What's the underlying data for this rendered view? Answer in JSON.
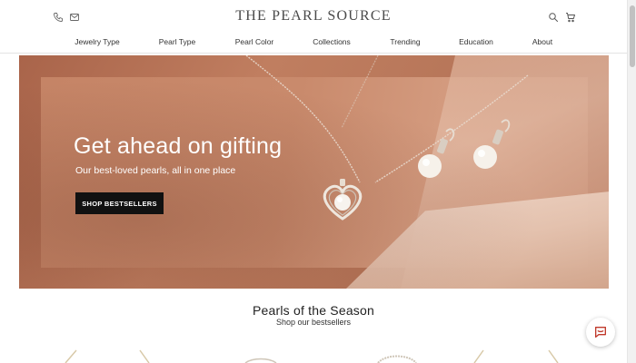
{
  "header": {
    "logo": "THE PEARL SOURCE",
    "icons": [
      "phone-icon",
      "mail-icon",
      "search-icon",
      "cart-icon"
    ]
  },
  "nav": {
    "items": [
      {
        "label": "Jewelry Type"
      },
      {
        "label": "Pearl Type"
      },
      {
        "label": "Pearl Color"
      },
      {
        "label": "Collections"
      },
      {
        "label": "Trending"
      },
      {
        "label": "Education"
      },
      {
        "label": "About"
      }
    ]
  },
  "hero": {
    "title": "Get ahead on gifting",
    "subtitle": "Our best-loved pearls, all in one place",
    "cta_label": "SHOP BESTSELLERS"
  },
  "section": {
    "title": "Pearls of the Season",
    "subtitle": "Shop our bestsellers"
  },
  "colors": {
    "hero_bg": "#b56f50",
    "cta_bg": "#111111",
    "text": "#222222"
  }
}
